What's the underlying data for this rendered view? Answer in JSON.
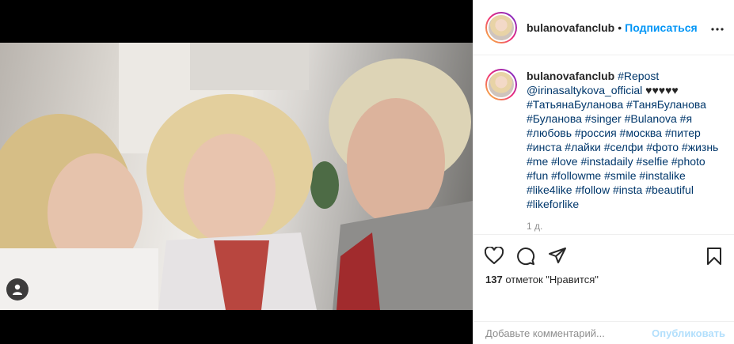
{
  "post": {
    "user_tag_icon": "person-icon"
  },
  "header": {
    "username": "bulanovafanclub",
    "separator": "•",
    "follow_label": "Подписаться",
    "more_icon": "ellipsis-icon",
    "more_label": "..."
  },
  "caption": {
    "username": "bulanovafanclub",
    "text_tags": [
      "#Repost",
      "@irinasaltykova_official",
      "♥♥♥♥♥",
      "#ТатьянаБуланова",
      "#ТаняБуланова",
      "#Буланова",
      "#singer",
      "#Bulanova",
      "#я",
      "#любовь",
      "#россия",
      "#москва",
      "#питер",
      "#инста",
      "#лайки",
      "#селфи",
      "#фото",
      "#жизнь",
      "#me",
      "#love",
      "#instadaily",
      "#selfie",
      "#photo",
      "#fun",
      "#followme",
      "#smile",
      "#instalike",
      "#like4like",
      "#follow",
      "#insta",
      "#beautiful",
      "#likeforlike"
    ],
    "time": "1 д."
  },
  "actions": {
    "like_icon": "heart-icon",
    "comment_icon": "comment-icon",
    "share_icon": "share-icon",
    "save_icon": "bookmark-icon"
  },
  "likes": {
    "count": "137",
    "text": "отметок \"Нравится\""
  },
  "comment_box": {
    "placeholder": "Добавьте комментарий...",
    "publish_label": "Опубликовать"
  },
  "colors": {
    "accent": "#0095f6",
    "publish_disabled": "#b2dffc",
    "tag": "#00376b",
    "muted": "#8e8e8e"
  }
}
